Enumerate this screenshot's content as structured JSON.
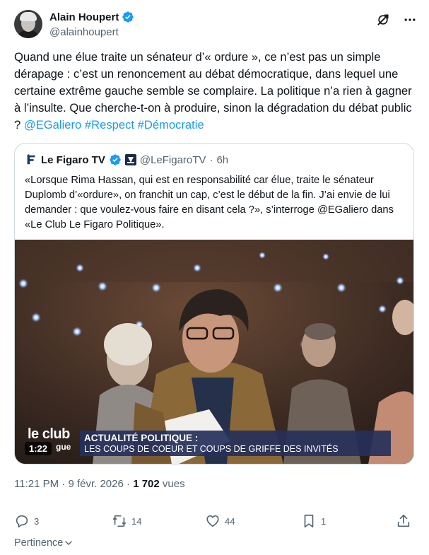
{
  "author": {
    "name": "Alain Houpert",
    "handle": "@alainhoupert"
  },
  "tweet": {
    "text": "Quand une élue traite un sénateur d’« ordure », ce n’est pas un simple dérapage : c’est un renoncement au débat démocratique, dans lequel une certaine extrême gauche semble se complaire. La politique n’a rien à gagner à l’insulte. Que cherche-t-on à produire, sinon la dégradation du débat public ? ",
    "links": [
      "@EGaliero",
      "#Respect",
      "#Démocratie"
    ]
  },
  "quote": {
    "name": "Le Figaro TV",
    "handle": "@LeFigaroTV",
    "separator": "·",
    "time": "6h",
    "text": "«Lorsque Rima Hassan, qui est en responsabilité car élue, traite le sénateur Duplomb d’«ordure», on franchit un cap, c’est le début de la fin. J’ai envie de lui demander : que voulez-vous faire en disant cela ?», s’interroge @EGaliero dans «Le Club Le Figaro Politique».",
    "media": {
      "logo_text": "le club",
      "logo_sub": "gue",
      "lower_third_title": "ACTUALITÉ POLITIQUE :",
      "lower_third_subtitle": "LES COUPS DE COEUR ET COUPS DE GRIFFE DES INVITÉS",
      "duration": "1:22"
    }
  },
  "meta": {
    "time": "11:21 PM",
    "separator": "·",
    "date": "9 févr. 2026",
    "views_count": "1 702",
    "views_label": "vues"
  },
  "actions": {
    "replies": "3",
    "reposts": "14",
    "likes": "44",
    "bookmarks": "1"
  },
  "sort_label": "Pertinence",
  "colors": {
    "link": "#1d9bf0",
    "verified": "#1d9bf0",
    "text": "#0f1419",
    "muted": "#536471",
    "border": "#cfd9de"
  }
}
